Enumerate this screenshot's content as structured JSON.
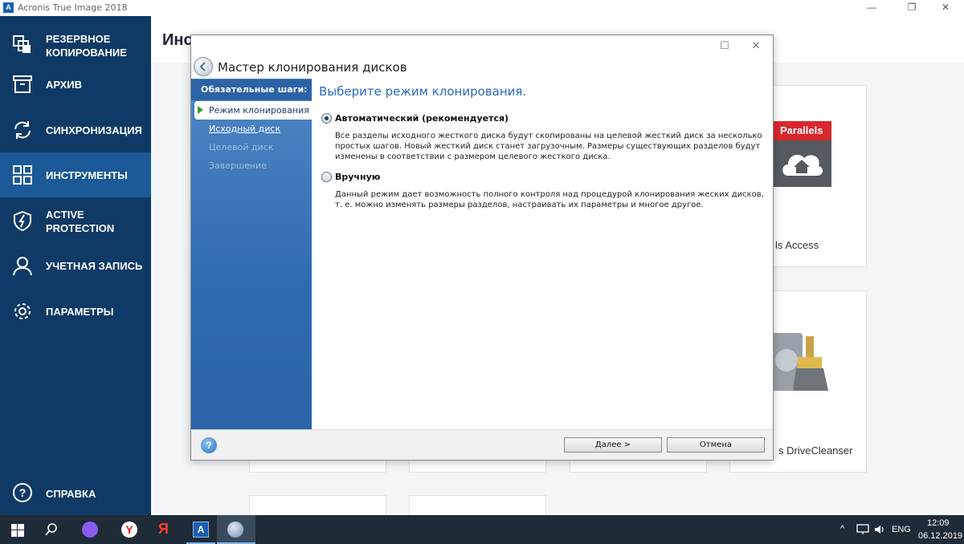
{
  "window": {
    "title": "Acronis True Image 2018",
    "minimize": "—",
    "maximize": "❐",
    "close": "✕"
  },
  "sidebar": {
    "items": [
      {
        "label": "РЕЗЕРВНОЕ КОПИРОВАНИЕ",
        "icon": "backup-icon"
      },
      {
        "label": "АРХИВ",
        "icon": "archive-icon"
      },
      {
        "label": "СИНХРОНИЗАЦИЯ",
        "icon": "sync-icon"
      },
      {
        "label": "ИНСТРУМЕНТЫ",
        "icon": "tools-icon",
        "active": true
      },
      {
        "label": "ACTIVE PROTECTION",
        "icon": "shield-icon"
      },
      {
        "label": "УЧЕТНАЯ ЗАПИСЬ",
        "icon": "user-icon"
      },
      {
        "label": "ПАРАМЕТРЫ",
        "icon": "gear-icon"
      }
    ],
    "help": "СПРАВКА"
  },
  "content": {
    "title": "Инс",
    "tiles": {
      "parallels_logo": "Parallels",
      "parallels_label": "ls Access",
      "drivecleanser_label": "s DriveCleanser"
    }
  },
  "wizard": {
    "title": "Мастер клонирования дисков",
    "steps_heading": "Обязательные шаги:",
    "steps": [
      {
        "label": "Режим клонирования",
        "state": "current"
      },
      {
        "label": "Исходный диск",
        "state": "link"
      },
      {
        "label": "Целевой диск",
        "state": "disabled"
      },
      {
        "label": "Завершение",
        "state": "disabled"
      }
    ],
    "heading": "Выберите режим клонирования.",
    "options": [
      {
        "label": "Автоматический (рекомендуется)",
        "selected": true,
        "description": "Все разделы исходного жесткого диска будут скопированы на целевой жесткий диск за несколько простых шагов. Новый жесткий диск станет загрузочным. Размеры существующих разделов будут изменены в соответствии с размером целевого жесткого диска."
      },
      {
        "label": "Вручную",
        "selected": false,
        "description": "Данный режим дает возможность полного контроля над процедурой клонирования жеских дисков, т. е. можно изменять размеры разделов, настраивать их параметры и многое другое."
      }
    ],
    "buttons": {
      "next": "Далее >",
      "cancel": "Отмена"
    },
    "help": "?"
  },
  "taskbar": {
    "language": "ENG",
    "time": "12:09",
    "date": "06.12.2019"
  },
  "colors": {
    "sidebar": "#0f3a66",
    "sidebar_active": "#1b5a96",
    "accent": "#2a6bbf",
    "taskbar": "#1f2b36"
  }
}
